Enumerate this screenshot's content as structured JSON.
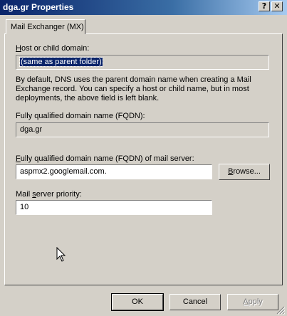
{
  "window": {
    "title": "dga.gr Properties",
    "help_glyph": "?",
    "close_glyph": "✕"
  },
  "tabs": [
    {
      "label": "Mail Exchanger (MX)",
      "selected": true
    }
  ],
  "form": {
    "host_label_mnemonic": "H",
    "host_label_rest": "ost or child domain:",
    "host_value": "(same as parent folder)",
    "description": "By default, DNS uses the parent domain name when creating a Mail Exchange record. You can specify a host or child name, but in most deployments, the above field is left blank.",
    "fqdn_label": "Fully qualified domain name (FQDN):",
    "fqdn_value": "dga.gr",
    "mail_server_label_mnemonic": "F",
    "mail_server_label_rest": "ully qualified domain name (FQDN) of mail server:",
    "mail_server_value": "aspmx2.googlemail.com.",
    "browse_mnemonic": "B",
    "browse_rest": "rowse...",
    "priority_label_pre": "Mail ",
    "priority_label_mnemonic": "s",
    "priority_label_rest": "erver priority:",
    "priority_value": "10"
  },
  "buttons": {
    "ok": "OK",
    "cancel": "Cancel",
    "apply_mnemonic": "A",
    "apply_rest": "pply"
  },
  "icons": {
    "cursor": "mouse-pointer-icon",
    "grip": "resize-grip-icon"
  }
}
